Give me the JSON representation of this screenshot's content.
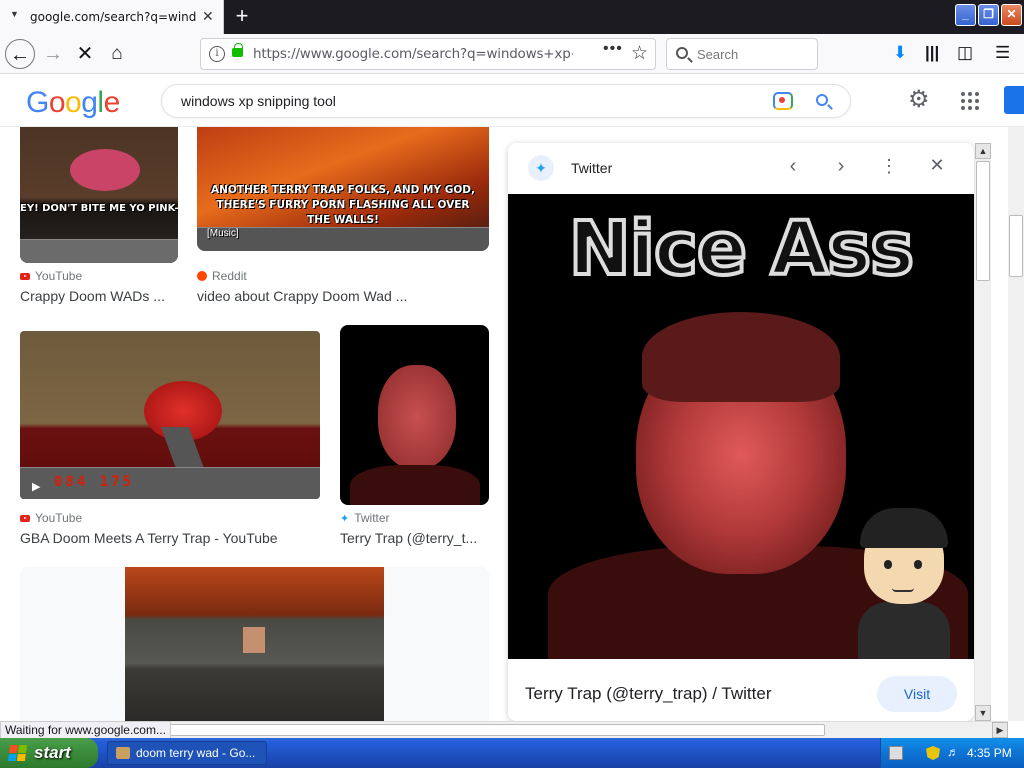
{
  "browser": {
    "tab_title": "google.com/search?q=windows+xp+snipping+tool",
    "url": "https://www.google.com/search?q=windows+xp+snipping+tool",
    "search_placeholder": "Search"
  },
  "google": {
    "logo": "Google",
    "query": "windows xp snipping tool"
  },
  "results": [
    {
      "source": "YouTube",
      "title": "Crappy Doom WADs ...",
      "overlay": "EY! DON'T BITE ME YO PINK-SKINNED FREAK!"
    },
    {
      "source": "Reddit",
      "title": "video about Crappy Doom Wad ...",
      "overlay": "ANOTHER TERRY TRAP FOLKS, AND MY GOD, THERE'S FURRY PORN FLASHING ALL OVER THE WALLS!",
      "badge": "[Music]"
    },
    {
      "source": "YouTube",
      "title": "GBA Doom Meets A Terry Trap - YouTube",
      "hud": "084 175"
    },
    {
      "source": "Twitter",
      "title": "Terry Trap (@terry_t..."
    }
  ],
  "preview": {
    "source": "Twitter",
    "image_text": "Nice Ass",
    "title": "Terry Trap (@terry_trap) / Twitter",
    "visit_label": "Visit"
  },
  "status": "Waiting for www.google.com...",
  "taskbar": {
    "start_label": "start",
    "task_label": "doom terry wad - Go...",
    "clock": "4:35 PM"
  },
  "colors": {
    "google_blue": "#4285f4",
    "google_red": "#ea4335",
    "google_yellow": "#fbbc05",
    "google_green": "#34a853",
    "xp_blue": "#245edc",
    "xp_green": "#3c8f3c"
  }
}
